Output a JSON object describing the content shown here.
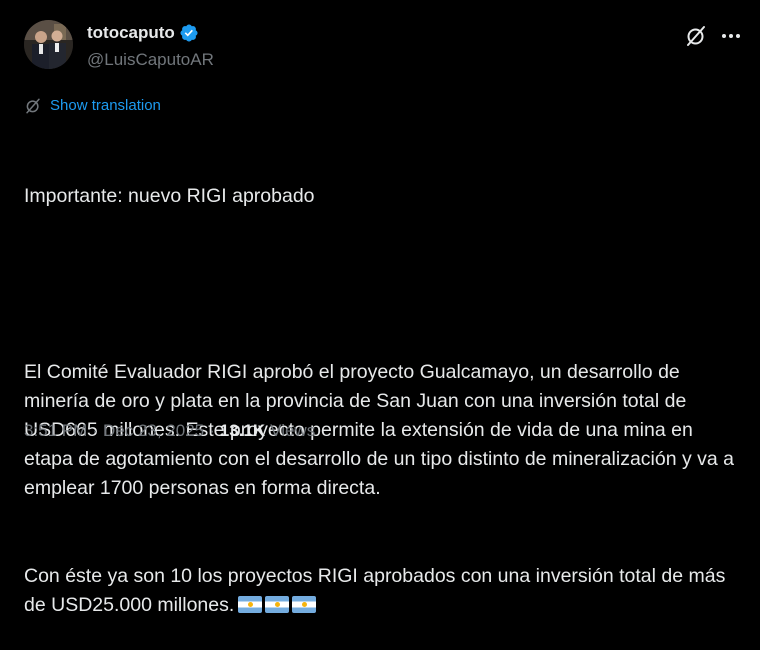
{
  "author": {
    "display_name": "totocaputo",
    "handle": "@LuisCaputoAR",
    "verified": true,
    "verified_color": "#1d9bf0"
  },
  "header_icons": [
    "grok-icon",
    "more-icon"
  ],
  "translate": {
    "label": "Show translation",
    "icon": "translate-icon"
  },
  "post": {
    "line_1": "Importante: nuevo RIGI aprobado",
    "paragraph_2": "El Comité Evaluador RIGI aprobó el proyecto Gualcamayo, un desarrollo de minería de oro y plata en la provincia de San Juan con una inversión total de USD665 millones. Este proyecto permite la extensión de vida de una mina en etapa de agotamiento con el desarrollo de un tipo distinto de mineralización y va a emplear 1700 personas en forma directa.",
    "paragraph_3": "Con éste ya son 10 los proyectos RIGI aprobados con una inversión total de más de USD25.000 millones.",
    "emojis": [
      "argentina-flag",
      "argentina-flag",
      "argentina-flag"
    ]
  },
  "meta": {
    "time": "3:51 PM",
    "separator": "·",
    "date": "Dec 23, 2025",
    "views_count": "13.1K",
    "views_label": "Views"
  },
  "colors": {
    "background": "#000000",
    "text": "#e7e9ea",
    "secondary": "#71767b",
    "accent": "#1d9bf0"
  }
}
